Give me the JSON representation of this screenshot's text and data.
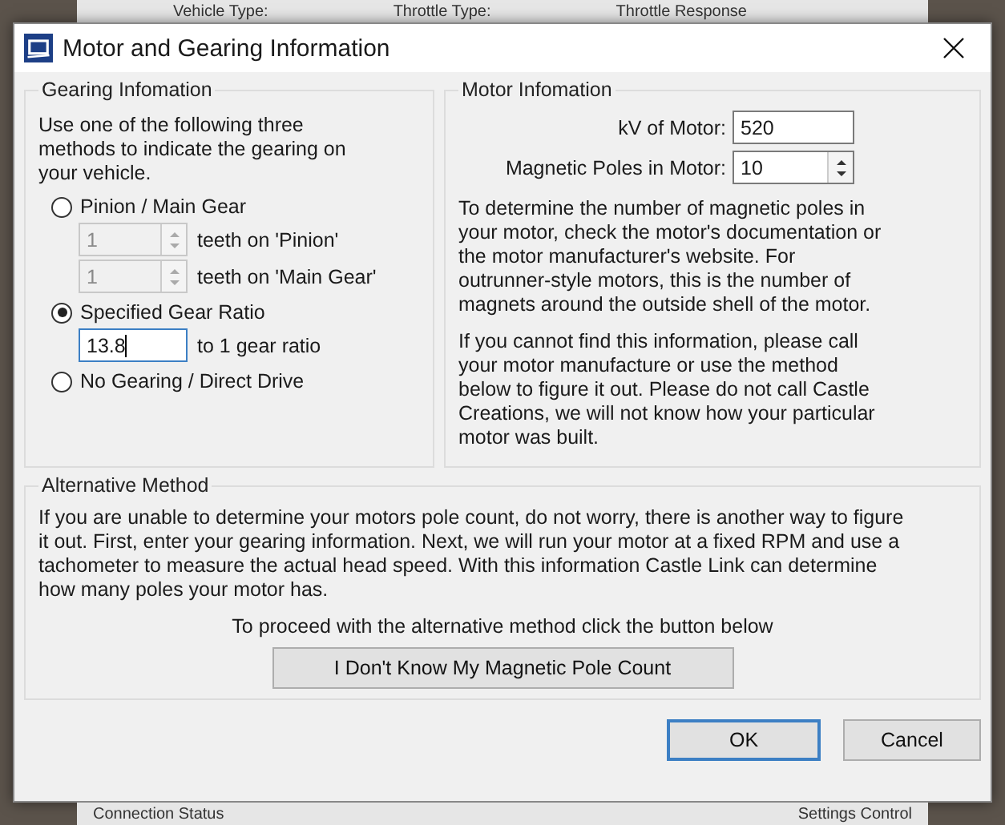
{
  "background": {
    "top_labels": [
      "Vehicle Type:",
      "Throttle Type:",
      "Throttle Response"
    ],
    "bottom_labels": [
      "Connection Status",
      "Settings Control"
    ]
  },
  "window": {
    "title": "Motor and Gearing Information"
  },
  "gearing": {
    "title": "Gearing Infomation",
    "intro": "Use one of the following three methods to indicate the gearing on your vehicle.",
    "options": [
      {
        "kind": "spinners",
        "label": "Pinion / Main Gear",
        "selected": false,
        "spinners": [
          {
            "value": "1",
            "suffix": "teeth on 'Pinion'",
            "disabled": true
          },
          {
            "value": "1",
            "suffix": "teeth on 'Main Gear'",
            "disabled": true
          }
        ]
      },
      {
        "kind": "ratio",
        "label": "Specified Gear Ratio",
        "selected": true,
        "value": "13.8",
        "suffix": "to 1 gear ratio"
      },
      {
        "kind": "plain",
        "label": "No Gearing / Direct Drive",
        "selected": false
      }
    ]
  },
  "motor": {
    "title": "Motor Infomation",
    "kv": {
      "label": "kV of Motor:",
      "value": "520"
    },
    "poles": {
      "label": "Magnetic Poles in Motor:",
      "value": "10"
    },
    "paragraphs": [
      "To determine the number of magnetic poles in your motor, check the motor's documentation or the motor manufacturer's website. For outrunner-style motors, this is the number of magnets around the outside shell of the motor.",
      "If you cannot find this information, please call your motor manufacture or use the method below to figure it out. Please do not call Castle Creations, we will not know how your particular motor was built."
    ]
  },
  "alternative": {
    "title": "Alternative Method",
    "text": "If you are unable to determine your motors pole count, do not worry, there is another way to figure it out. First, enter your gearing information. Next, we will run your motor at a fixed RPM and use a tachometer to measure the actual head speed. With this information Castle Link can determine how many poles your motor has.",
    "prompt": "To proceed with the alternative method click the button below",
    "button": "I Don't Know My Magnetic Pole Count"
  },
  "buttons": [
    {
      "label": "OK",
      "default": true
    },
    {
      "label": "Cancel",
      "default": false
    }
  ]
}
